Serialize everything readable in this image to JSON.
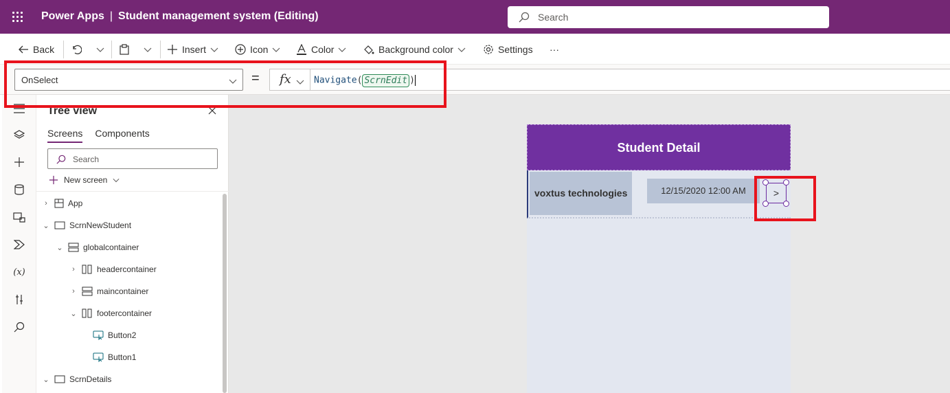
{
  "header": {
    "app_name": "Power Apps",
    "separator": "|",
    "document_title": "Student management system (Editing)",
    "search_placeholder": "Search"
  },
  "commandbar": {
    "back": "Back",
    "insert": "Insert",
    "icon": "Icon",
    "color": "Color",
    "background_color": "Background color",
    "settings": "Settings",
    "more": "···"
  },
  "formula": {
    "property": "OnSelect",
    "equals": "=",
    "fx": "fx",
    "function_name": "Navigate",
    "open_paren": "(",
    "argument": "ScrnEdit",
    "close_paren": ")"
  },
  "tree_view": {
    "title": "Tree view",
    "tabs": [
      "Screens",
      "Components"
    ],
    "search_placeholder": "Search",
    "new_screen": "New screen",
    "nodes": [
      {
        "label": "App"
      },
      {
        "label": "ScrnNewStudent"
      },
      {
        "label": "globalcontainer"
      },
      {
        "label": "headercontainer"
      },
      {
        "label": "maincontainer"
      },
      {
        "label": "footercontainer"
      },
      {
        "label": "Button2"
      },
      {
        "label": "Button1"
      },
      {
        "label": "ScrnDetails"
      }
    ]
  },
  "canvas": {
    "header_title": "Student Detail",
    "row_name": "voxtus technologies",
    "row_date": "12/15/2020 12:00 AM",
    "nav_glyph": ">"
  },
  "icons": {
    "rail": [
      "hamburger-icon",
      "layers-icon",
      "plus-icon",
      "database-icon",
      "media-icon",
      "power-automate-icon",
      "variables-icon",
      "tools-icon",
      "search-icon"
    ]
  },
  "colors": {
    "header_bg": "#742774",
    "screen_header_bg": "#7030a0",
    "highlight": "#e8131c"
  }
}
